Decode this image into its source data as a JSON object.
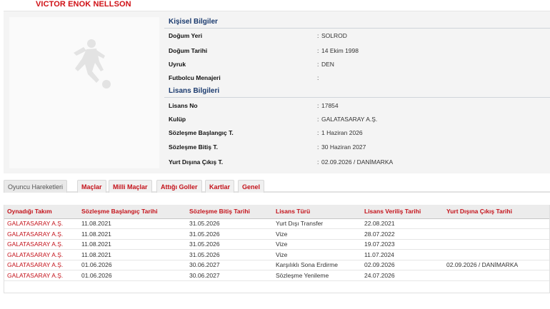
{
  "player": {
    "name": "VICTOR ENOK NELLSON"
  },
  "personal": {
    "title": "Kişisel Bilgiler",
    "rows": [
      {
        "label": "Doğum Yeri",
        "value": "SOLROD"
      },
      {
        "label": "Doğum Tarihi",
        "value": "14 Ekim 1998"
      },
      {
        "label": "Uyruk",
        "value": "DEN"
      },
      {
        "label": "Futbolcu Menajeri",
        "value": ""
      }
    ]
  },
  "license": {
    "title": "Lisans Bilgileri",
    "rows": [
      {
        "label": "Lisans No",
        "value": "17854"
      },
      {
        "label": "Kulüp",
        "value": "GALATASARAY A.Ş."
      },
      {
        "label": "Sözleşme Başlangıç T.",
        "value": "1 Haziran 2026"
      },
      {
        "label": "Sözleşme Bitiş T.",
        "value": "30 Haziran 2027"
      },
      {
        "label": "Yurt Dışına Çıkış T.",
        "value": "02.09.2026 / DANİMARKA"
      }
    ]
  },
  "tabs": [
    {
      "label": "Oyuncu Hareketleri"
    },
    {
      "label": "Maçlar"
    },
    {
      "label": "Milli Maçlar"
    },
    {
      "label": "Attığı Goller"
    },
    {
      "label": "Kartlar"
    },
    {
      "label": "Genel"
    }
  ],
  "colors": {
    "accent": "#c4121a",
    "heading": "#1a3a6e",
    "panel": "#f4f4f4"
  },
  "icons": {
    "player_photo": "player-silhouette-icon"
  },
  "movements": {
    "headers": [
      "Oynadığı Takım",
      "Sözleşme Başlangıç Tarihi",
      "Sözleşme Bitiş Tarihi",
      "Lisans Türü",
      "Lisans Veriliş Tarihi",
      "Yurt Dışına Çıkış Tarihi"
    ],
    "rows": [
      [
        "GALATASARAY A.Ş.",
        "11.08.2021",
        "31.05.2026",
        "Yurt Dışı Transfer",
        "22.08.2021",
        ""
      ],
      [
        "GALATASARAY A.Ş.",
        "11.08.2021",
        "31.05.2026",
        "Vize",
        "28.07.2022",
        ""
      ],
      [
        "GALATASARAY A.Ş.",
        "11.08.2021",
        "31.05.2026",
        "Vize",
        "19.07.2023",
        ""
      ],
      [
        "GALATASARAY A.Ş.",
        "11.08.2021",
        "31.05.2026",
        "Vize",
        "11.07.2024",
        ""
      ],
      [
        "GALATASARAY A.Ş.",
        "01.06.2026",
        "30.06.2027",
        "Karşılıklı Sona Erdirme",
        "02.09.2026",
        "02.09.2026 / DANİMARKA"
      ],
      [
        "GALATASARAY A.Ş.",
        "01.06.2026",
        "30.06.2027",
        "Sözleşme Yenileme",
        "24.07.2026",
        ""
      ]
    ]
  }
}
